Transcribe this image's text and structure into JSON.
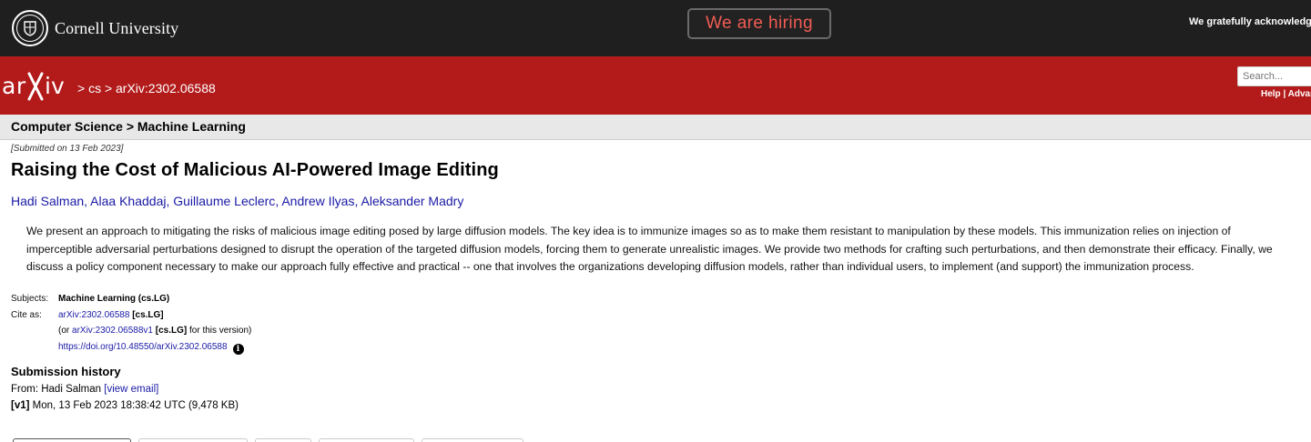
{
  "topbar": {
    "university_name": "Cornell University",
    "hiring_label": "We are hiring",
    "acknowledge_text": "We gratefully acknowledge s"
  },
  "header": {
    "crumbs": "> cs > arXiv:2302.06588",
    "search_placeholder": "Search...",
    "help_text": "Help | Advar"
  },
  "subject_bar": {
    "title": "Computer Science > Machine Learning"
  },
  "paper": {
    "submitted": "[Submitted on 13 Feb 2023]",
    "title": "Raising the Cost of Malicious AI-Powered Image Editing",
    "authors": [
      "Hadi Salman",
      "Alaa Khaddaj",
      "Guillaume Leclerc",
      "Andrew Ilyas",
      "Aleksander Madry"
    ],
    "abstract": "We present an approach to mitigating the risks of malicious image editing posed by large diffusion models. The key idea is to immunize images so as to make them resistant to manipulation by these models. This immunization relies on injection of imperceptible adversarial perturbations designed to disrupt the operation of the targeted diffusion models, forcing them to generate unrealistic images. We provide two methods for crafting such perturbations, and then demonstrate their efficacy. Finally, we discuss a policy component necessary to make our approach fully effective and practical -- one that involves the organizations developing diffusion models, rather than individual users, to implement (and support) the immunization process."
  },
  "meta": {
    "subjects_label": "Subjects:",
    "subjects_value": "Machine Learning (cs.LG)",
    "cite_label": "Cite as:",
    "cite_id": "arXiv:2302.06588",
    "cite_cat": "[cs.LG]",
    "or_prefix": "(or",
    "version_id": "arXiv:2302.06588v1",
    "version_cat": "[cs.LG]",
    "version_suffix": "for this version)",
    "doi": "https://doi.org/10.48550/arXiv.2302.06588"
  },
  "history": {
    "title": "Submission history",
    "from_label": "From: Hadi Salman",
    "view_email": "[view email]",
    "v1_tag": "[v1]",
    "v1_text": "Mon, 13 Feb 2023 18:38:42 UTC (9,478 KB)"
  },
  "colors": {
    "arxiv_red": "#b31b1b",
    "topbar": "#1f1f1f",
    "hiring_text": "#f25c54",
    "link": "#1a1aa6"
  }
}
